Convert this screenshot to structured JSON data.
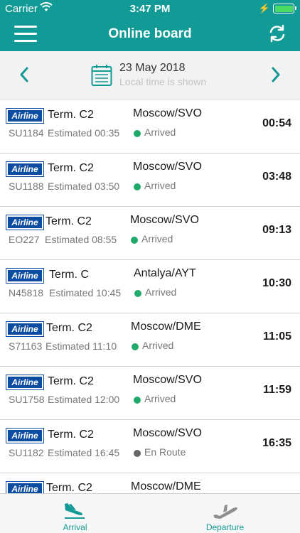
{
  "status_bar": {
    "carrier": "Carrier",
    "time": "3:47 PM"
  },
  "header": {
    "title": "Online board",
    "accent": "#129a96"
  },
  "date_bar": {
    "date": "23 May 2018",
    "note": "Local time is shown"
  },
  "flights": [
    {
      "airline": "Airline",
      "terminal": "Term. C2",
      "flight": "SU1184",
      "estimated": "Estimated 00:35",
      "destination": "Moscow/SVO",
      "status": "Arrived",
      "status_color": "#1faa6b",
      "time": "00:54"
    },
    {
      "airline": "Airline",
      "terminal": "Term. C2",
      "flight": "SU1188",
      "estimated": "Estimated 03:50",
      "destination": "Moscow/SVO",
      "status": "Arrived",
      "status_color": "#1faa6b",
      "time": "03:48"
    },
    {
      "airline": "Airline",
      "terminal": "Term. C2",
      "flight": "EO227",
      "estimated": "Estimated 08:55",
      "destination": "Moscow/SVO",
      "status": "Arrived",
      "status_color": "#1faa6b",
      "time": "09:13"
    },
    {
      "airline": "Airline",
      "terminal": "Term. C",
      "flight": "N45818",
      "estimated": "Estimated 10:45",
      "destination": "Antalya/AYT",
      "status": "Arrived",
      "status_color": "#1faa6b",
      "time": "10:30"
    },
    {
      "airline": "Airline",
      "terminal": "Term. C2",
      "flight": "S71163",
      "estimated": "Estimated 11:10",
      "destination": "Moscow/DME",
      "status": "Arrived",
      "status_color": "#1faa6b",
      "time": "11:05"
    },
    {
      "airline": "Airline",
      "terminal": "Term. C2",
      "flight": "SU1758",
      "estimated": "Estimated 12:00",
      "destination": "Moscow/SVO",
      "status": "Arrived",
      "status_color": "#1faa6b",
      "time": "11:59"
    },
    {
      "airline": "Airline",
      "terminal": "Term. C2",
      "flight": "SU1182",
      "estimated": "Estimated 16:45",
      "destination": "Moscow/SVO",
      "status": "En Route",
      "status_color": "#666666",
      "time": "16:35"
    },
    {
      "airline": "Airline",
      "terminal": "Term. C2",
      "flight": "",
      "estimated": "",
      "destination": "Moscow/DME",
      "status": "",
      "status_color": "",
      "time": ""
    }
  ],
  "tabs": [
    {
      "label": "Arrival",
      "icon": "plane-landing-icon"
    },
    {
      "label": "Departure",
      "icon": "plane-takeoff-icon"
    }
  ]
}
